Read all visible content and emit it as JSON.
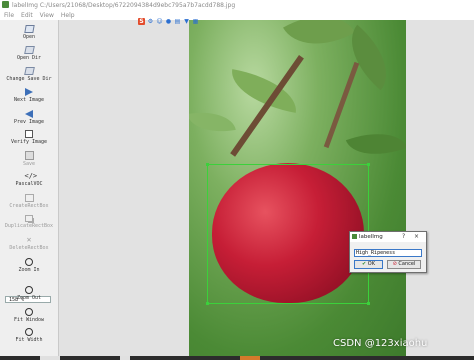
{
  "window": {
    "title": "labelImg C:/Users/21068/Desktop/6722094384d9ebc795a7b7acdd788.jpg"
  },
  "menu": [
    "File",
    "Edit",
    "View",
    "Help"
  ],
  "toolbar": {
    "open": "Open",
    "open_dir": "Open Dir",
    "change_save_dir": "Change Save Dir",
    "next_image": "Next Image",
    "prev_image": "Prev Image",
    "verify_image": "Verify Image",
    "save": "Save",
    "format": "PascalVOC",
    "create_rect": "CreateRectBox",
    "duplicate_rect": "DuplicateRectBox",
    "delete_rect": "DeleteRectBox",
    "zoom_in": "Zoom In",
    "zoom_value": "158 %",
    "zoom_out": "Zoom Out",
    "fit_window": "Fit Window",
    "fit_width": "Fit Width"
  },
  "ime_bar": {
    "logo": "S",
    "icons": [
      "wrench-icon",
      "emoji-icon",
      "mic-icon",
      "keyboard-icon",
      "shirt-icon",
      "grid-icon"
    ]
  },
  "dialog": {
    "title": "labelImg",
    "help_symbol": "?",
    "close_symbol": "×",
    "input_value": "High_Ripeness",
    "ok_label": "OK",
    "cancel_label": "Cancel"
  },
  "watermark": "CSDN @123xiaohu",
  "colors": {
    "bbox": "#3bd13b",
    "accent": "#3a78c8"
  }
}
